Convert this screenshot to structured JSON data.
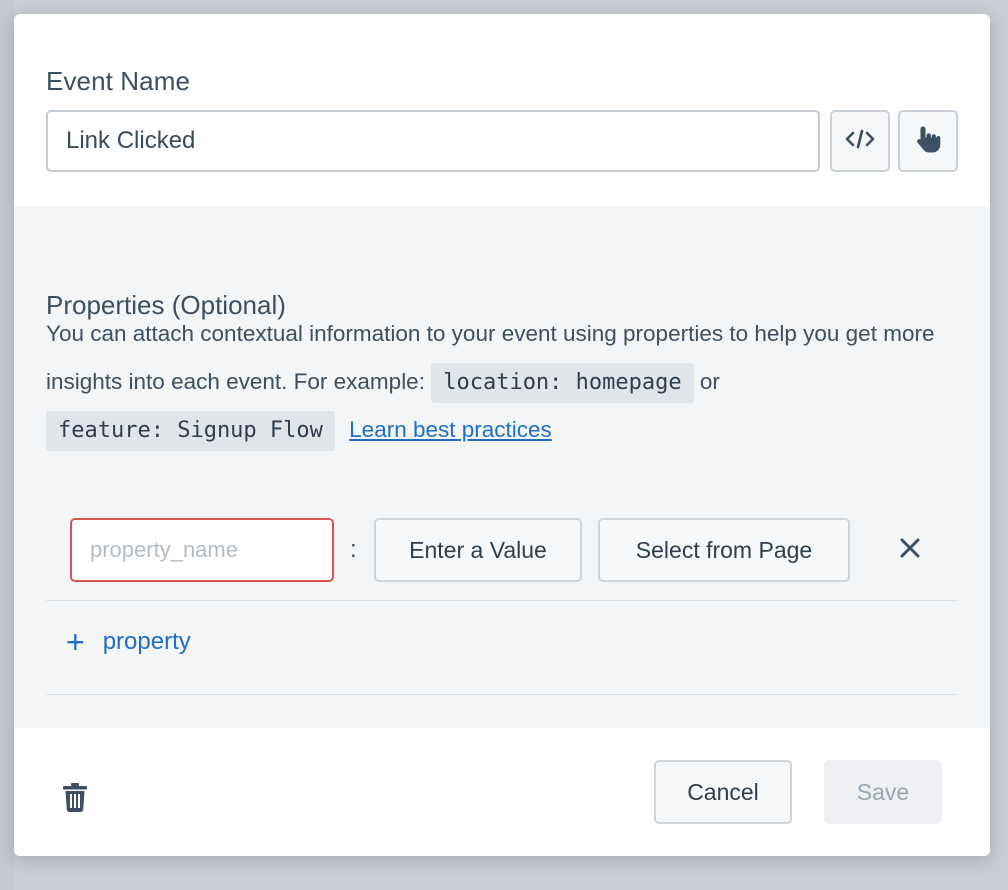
{
  "event": {
    "label": "Event Name",
    "value": "Link Clicked",
    "code_icon": "code-icon",
    "pointer_icon": "hand-pointer-icon"
  },
  "properties": {
    "title": "Properties (Optional)",
    "desc_part1": "You can attach contextual information to your event using properties to help you get more insights into each event. For example:",
    "example1": "location: homepage",
    "or_text": "or",
    "example2": "feature: Signup Flow",
    "learn_link": "Learn best practices",
    "row": {
      "name_placeholder": "property_name",
      "colon": ":",
      "enter_value": "Enter a Value",
      "select_from_page": "Select from Page",
      "remove_icon": "close-icon"
    },
    "add_label": "property"
  },
  "footer": {
    "trash_icon": "trash-icon",
    "cancel": "Cancel",
    "save": "Save"
  },
  "colors": {
    "accent": "#1f6fc4",
    "error_border": "#d9534f"
  }
}
